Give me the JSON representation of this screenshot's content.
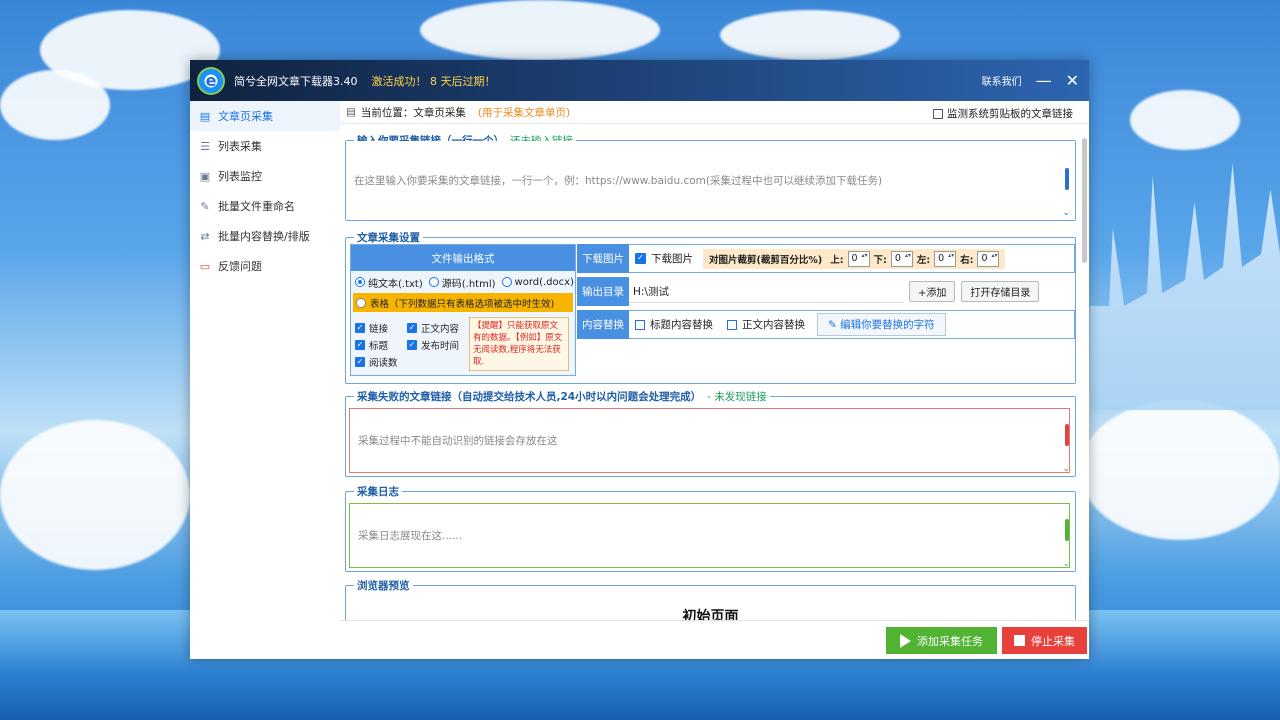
{
  "window": {
    "title": "简兮全网文章下载器3.40",
    "activation": "激活成功！ 8 天后过期！",
    "contact": "联系我们",
    "minimize_glyph": "—",
    "close_glyph": "✕"
  },
  "sidebar": {
    "items": [
      {
        "label": "文章页采集",
        "icon": "doc-icon",
        "active": true
      },
      {
        "label": "列表采集",
        "icon": "list-search-icon"
      },
      {
        "label": "列表监控",
        "icon": "monitor-icon"
      },
      {
        "label": "批量文件重命名",
        "icon": "rename-icon"
      },
      {
        "label": "批量内容替换/排版",
        "icon": "replace-icon"
      },
      {
        "label": "反馈问题",
        "icon": "feedback-icon"
      }
    ]
  },
  "breadcrumb": {
    "prefix": "当前位置：",
    "current": "文章页采集",
    "hint": "(用于采集文章单页)",
    "monitor_label": "监测系统剪贴板的文章链接"
  },
  "url_input": {
    "title": "输入你要采集链接（一行一个）",
    "status": "还未输入链接",
    "placeholder": "在这里输入你要采集的文章链接，一行一个，例：https://www.baidu.com(采集过程中也可以继续添加下载任务)"
  },
  "settings": {
    "title": "文章采集设置",
    "format_header": "文件输出格式",
    "formats": [
      "纯文本(.txt)",
      "源码(.html)",
      "word(.docx)"
    ],
    "table_label": "表格（下列数据只有表格选项被选中时生效)",
    "fields": [
      "链接",
      "正文内容",
      "标题",
      "发布时间",
      "阅读数"
    ],
    "notice": "【提醒】只能获取原文有的数据。【例如】原文无阅读数,程序将无法获取.",
    "download_images_label": "下载图片",
    "download_images_check": "下载图片",
    "crop_label": "对图片裁剪(裁剪百分比%)",
    "crop": [
      {
        "side": "上:",
        "value": "0"
      },
      {
        "side": "下:",
        "value": "0"
      },
      {
        "side": "左:",
        "value": "0"
      },
      {
        "side": "右:",
        "value": "0"
      }
    ],
    "output_label": "输出目录",
    "output_path": "H:\\测试",
    "add_button": "+添加",
    "open_dir_button": "打开存储目录",
    "replace_label": "内容替换",
    "title_replace": "标题内容替换",
    "body_replace": "正文内容替换",
    "edit_button": "编辑你要替换的字符"
  },
  "failed": {
    "title": "采集失败的文章链接（自动提交给技术人员,24小时以内问题会处理完成）",
    "status": "- 未发现链接",
    "placeholder": "采集过程中不能自动识别的链接会存放在这"
  },
  "log": {
    "title": "采集日志",
    "placeholder": "采集日志展现在这......"
  },
  "preview": {
    "title": "浏览器预览",
    "page_title": "初始页面"
  },
  "footer": {
    "add_task": "添加采集任务",
    "stop": "停止采集"
  }
}
